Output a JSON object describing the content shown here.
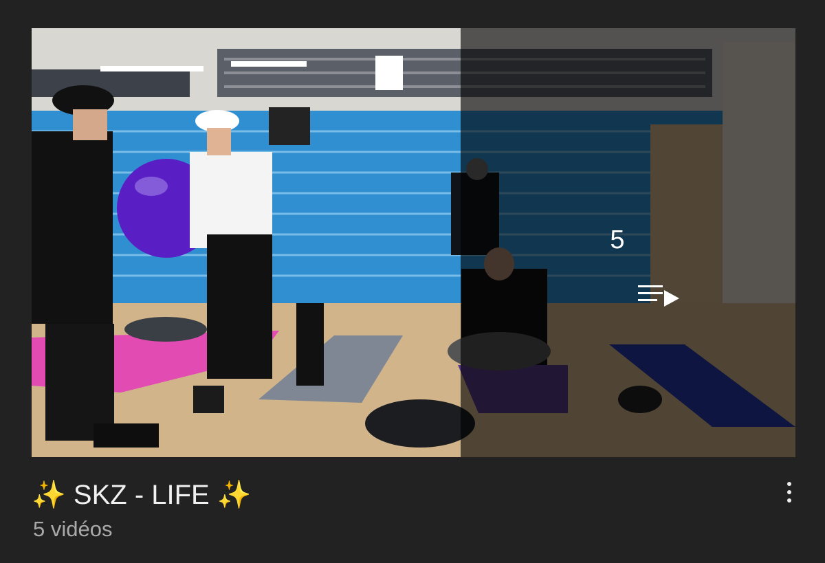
{
  "playlist": {
    "title": "✨ SKZ - LIFE ✨",
    "video_count_label": "5 vidéos",
    "overlay_count": "5",
    "thumbnail_description_icon": "playlist-play-icon",
    "menu_icon": "more-vertical-icon"
  },
  "colors": {
    "background": "#222222",
    "title": "#f1f1f1",
    "subtitle": "#aaaaaa",
    "overlay_text": "#ffffff"
  }
}
